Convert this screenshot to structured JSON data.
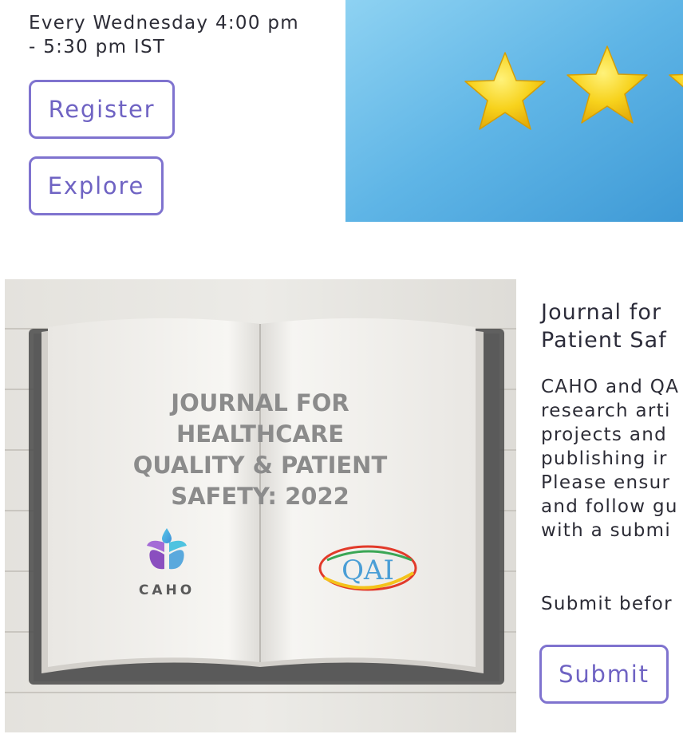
{
  "webinar": {
    "schedule_line1": "Every Wednesday 4:00 pm",
    "schedule_line2": "- 5:30 pm IST",
    "register_label": "Register",
    "explore_label": "Explore"
  },
  "journal": {
    "title_line1": "Journal for",
    "title_line2": "Patient Saf",
    "body_lines": [
      "CAHO and QA",
      "research arti",
      "projects and",
      "publishing ir",
      "Please ensur",
      "and follow gu",
      "with a submi"
    ],
    "deadline": "Submit befor",
    "submit_label": "Submit",
    "cover": {
      "title_lines": [
        "JOURNAL FOR",
        "HEALTHCARE",
        "QUALITY & PATIENT",
        "SAFETY: 2022"
      ],
      "logo_left_text": "CAHO",
      "logo_right_text": "QAI"
    }
  },
  "colors": {
    "accent": "#7f73cf",
    "sky": "#5fb5e6",
    "star": "#f5cf1d"
  }
}
